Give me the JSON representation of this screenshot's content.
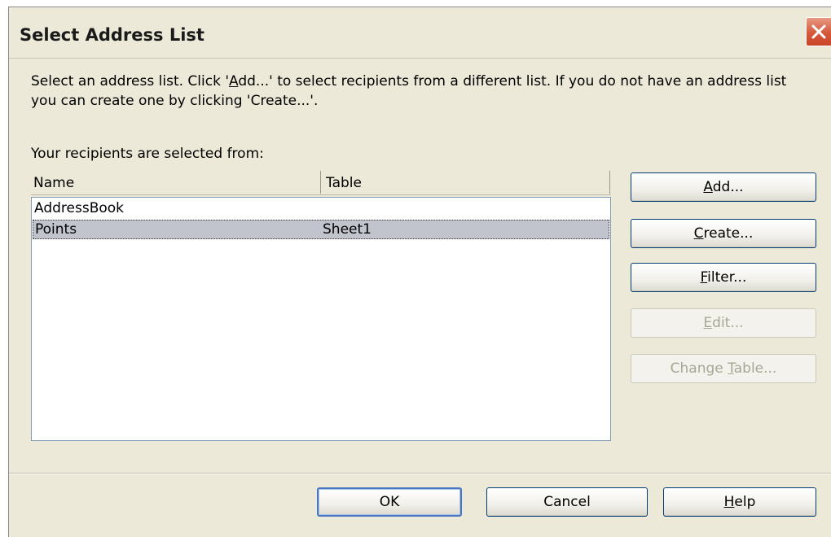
{
  "window": {
    "title": "Select Address List"
  },
  "intro": {
    "pre": "Select an address list. Click '",
    "add_mnemonic": "A",
    "add_rest": "dd...' to select recipients from a different list. If you do not have an address list you can create one by clicking 'Create...'."
  },
  "selected_from_label": "Your recipients are selected from:",
  "list": {
    "columns": [
      "Name",
      "Table"
    ],
    "rows": [
      {
        "name": "AddressBook",
        "table": "",
        "selected": false
      },
      {
        "name": "Points",
        "table": "Sheet1",
        "selected": true
      }
    ]
  },
  "side_buttons": {
    "add": {
      "mnemonic": "A",
      "rest": "dd..."
    },
    "create": {
      "mnemonic": "C",
      "rest": "reate..."
    },
    "filter": {
      "mnemonic": "F",
      "rest": "ilter..."
    },
    "edit": {
      "mnemonic": "E",
      "rest": "dit...",
      "disabled": true
    },
    "change_table": {
      "pre": "Change ",
      "mnemonic": "T",
      "rest": "able...",
      "disabled": true
    }
  },
  "footer": {
    "ok": "OK",
    "cancel": "Cancel",
    "help": {
      "mnemonic": "H",
      "rest": "elp"
    }
  },
  "colors": {
    "dialog_bg": "#ece9d8",
    "button_border": "#003c74",
    "selection": "#c1c4cc",
    "close_red": "#d5583b"
  },
  "icons": {
    "close": "close-icon"
  }
}
